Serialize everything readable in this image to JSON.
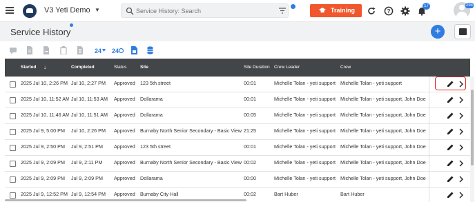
{
  "app": {
    "title": "V3 Yeti Demo",
    "notification_count": "17",
    "corner_badge": "294"
  },
  "search": {
    "placeholder": "Service History: Search"
  },
  "buttons": {
    "training": "Training",
    "add": "+"
  },
  "page": {
    "title": "Service History"
  },
  "grid": {
    "columns": [
      "Started",
      "Completed",
      "Status",
      "Site",
      "Site Duration",
      "Crew Leader",
      "Crew"
    ],
    "rows": [
      {
        "started": "2025 Jul 10, 2:26 PM",
        "completed": "Jul 10, 2:27 PM",
        "status": "Approved",
        "site": "123 5th street",
        "duration": "00:01",
        "leader": "Michelle Tolan - yeti support",
        "crew": "Michelle Tolan - yeti support"
      },
      {
        "started": "2025 Jul 10, 11:52 AM",
        "completed": "Jul 10, 11:53 AM",
        "status": "Approved",
        "site": "Dollarama",
        "duration": "00:01",
        "leader": "Michelle Tolan - yeti support",
        "crew": "Michelle Tolan - yeti support, John Doe"
      },
      {
        "started": "2025 Jul 10, 11:46 AM",
        "completed": "Jul 10, 11:51 AM",
        "status": "Approved",
        "site": "Dollarama",
        "duration": "00:05",
        "leader": "Michelle Tolan - yeti support",
        "crew": "Michelle Tolan - yeti support, John Doe"
      },
      {
        "started": "2025 Jul 9, 5:00 PM",
        "completed": "Jul 10, 2:26 PM",
        "status": "Approved",
        "site": "Burnaby North Senior Secondary - Basic View",
        "duration": "21:25",
        "leader": "Michelle Tolan - yeti support",
        "crew": "Michelle Tolan - yeti support, John Doe"
      },
      {
        "started": "2025 Jul 9, 2:50 PM",
        "completed": "Jul 9, 2:51 PM",
        "status": "Approved",
        "site": "123 5th street",
        "duration": "00:01",
        "leader": "Michelle Tolan - yeti support",
        "crew": "Michelle Tolan - yeti support, John Doe"
      },
      {
        "started": "2025 Jul 9, 2:09 PM",
        "completed": "Jul 9, 2:11 PM",
        "status": "Approved",
        "site": "Burnaby North Senior Secondary - Basic View",
        "duration": "00:02",
        "leader": "Michelle Tolan - yeti support",
        "crew": "Michelle Tolan - yeti support, John Doe"
      },
      {
        "started": "2025 Jul 9, 2:09 PM",
        "completed": "Jul 9, 2:09 PM",
        "status": "Approved",
        "site": "Dollarama",
        "duration": "00:00",
        "leader": "Michelle Tolan - yeti support",
        "crew": "Michelle Tolan - yeti support, John Doe"
      },
      {
        "started": "2025 Jul 9, 12:52 PM",
        "completed": "Jul 9, 12:54 PM",
        "status": "Approved",
        "site": "Burnaby City Hall",
        "duration": "00:02",
        "leader": "Bart Huber",
        "crew": "Bart Huber"
      }
    ]
  },
  "colors": {
    "accent": "#2f7de1",
    "training": "#f0572d",
    "grid_header": "#424649",
    "highlight": "#d6281e"
  }
}
